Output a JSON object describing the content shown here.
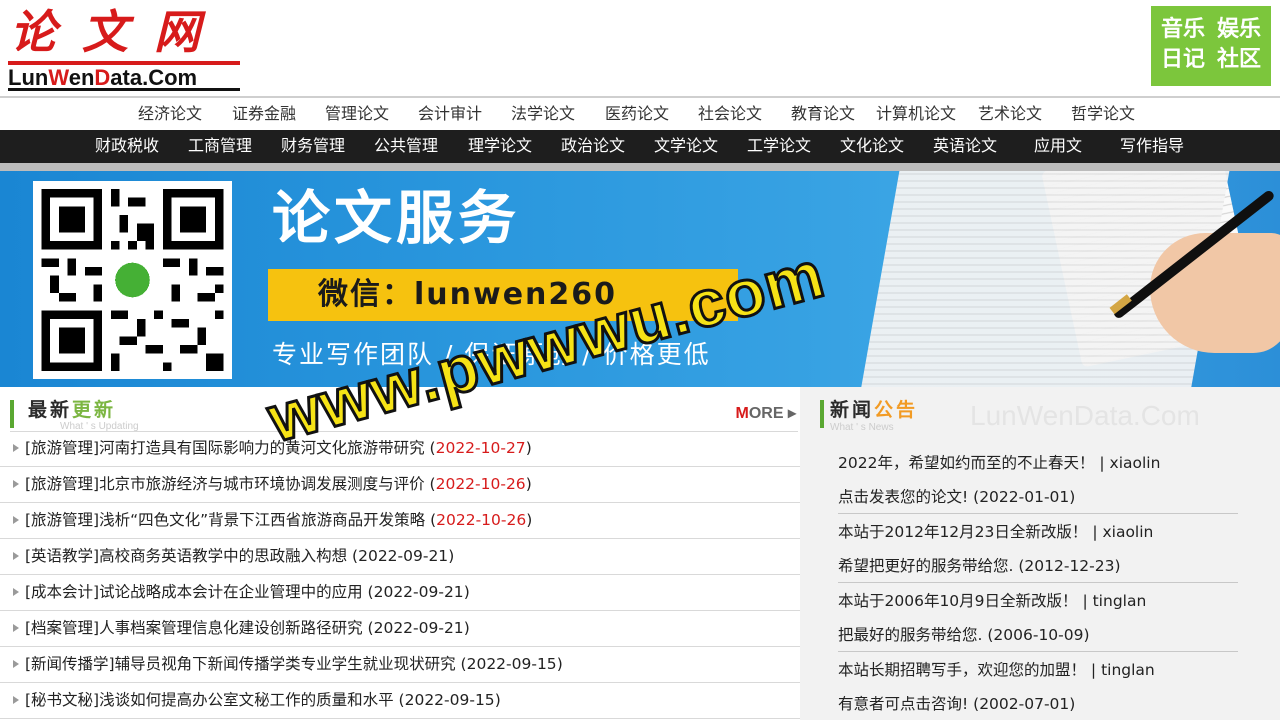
{
  "header": {
    "logo_cn": "论文网",
    "logo_en_parts": [
      "Lun",
      "W",
      "en",
      "D",
      "ata.Com"
    ],
    "badge": [
      "音乐",
      "娱乐",
      "日记",
      "社区"
    ]
  },
  "nav_top": [
    "经济论文",
    "证券金融",
    "管理论文",
    "会计审计",
    "法学论文",
    "医药论文",
    "社会论文",
    "教育论文",
    "计算机论文",
    "艺术论文",
    "哲学论文"
  ],
  "nav_bottom": [
    "财政税收",
    "工商管理",
    "财务管理",
    "公共管理",
    "理学论文",
    "政治论文",
    "文学论文",
    "工学论文",
    "文化论文",
    "英语论文",
    "应用文",
    "写作指导"
  ],
  "banner": {
    "title": "论文服务",
    "wechat": "微信：lunwen260",
    "slogan": "专业写作团队 / 保证原创 / 价格更低"
  },
  "latest": {
    "title_a": "最新",
    "title_b": "更新",
    "subtitle": "What ' s Updating",
    "more_m": "M",
    "more_rest": "ORE ▸",
    "items": [
      {
        "text": "[旅游管理]河南打造具有国际影响力的黄河文化旅游带研究",
        "date": "2022-10-27",
        "red": true
      },
      {
        "text": "[旅游管理]北京市旅游经济与城市环境协调发展测度与评价",
        "date": "2022-10-26",
        "red": true
      },
      {
        "text": "[旅游管理]浅析“四色文化”背景下江西省旅游商品开发策略",
        "date": "2022-10-26",
        "red": true
      },
      {
        "text": "[英语教学]高校商务英语教学中的思政融入构想",
        "date": "2022-09-21",
        "red": false
      },
      {
        "text": "[成本会计]试论战略成本会计在企业管理中的应用",
        "date": "2022-09-21",
        "red": false
      },
      {
        "text": "[档案管理]人事档案管理信息化建设创新路径研究",
        "date": "2022-09-21",
        "red": false
      },
      {
        "text": "[新闻传播学]辅导员视角下新闻传播学类专业学生就业现状研究",
        "date": "2022-09-15",
        "red": false
      },
      {
        "text": "[秘书文秘]浅谈如何提高办公室文秘工作的质量和水平",
        "date": "2022-09-15",
        "red": false
      }
    ]
  },
  "news": {
    "title_a": "新闻",
    "title_b": "公告",
    "subtitle": "What ' s News",
    "watermark": "LunWenData.Com",
    "items": [
      {
        "line1": "2022年，希望如约而至的不止春天！ | xiaolin",
        "line2": "点击发表您的论文! (2022-01-01)"
      },
      {
        "line1": "本站于2012年12月23日全新改版！ | xiaolin",
        "line2": "希望把更好的服务带给您. (2012-12-23)"
      },
      {
        "line1": "本站于2006年10月9日全新改版！ | tinglan",
        "line2": "把最好的服务带给您. (2006-10-09)"
      },
      {
        "line1": "本站长期招聘写手，欢迎您的加盟！ | tinglan",
        "line2": "有意者可点击咨询! (2002-07-01)"
      }
    ]
  },
  "watermark": "www.pwwwu.com",
  "colors": {
    "brand_red": "#d71b1b",
    "nav_dark": "#1e1e1e",
    "banner_blue": "#2b98de",
    "accent_yellow": "#f6c20f",
    "badge_green": "#7cc63c"
  }
}
